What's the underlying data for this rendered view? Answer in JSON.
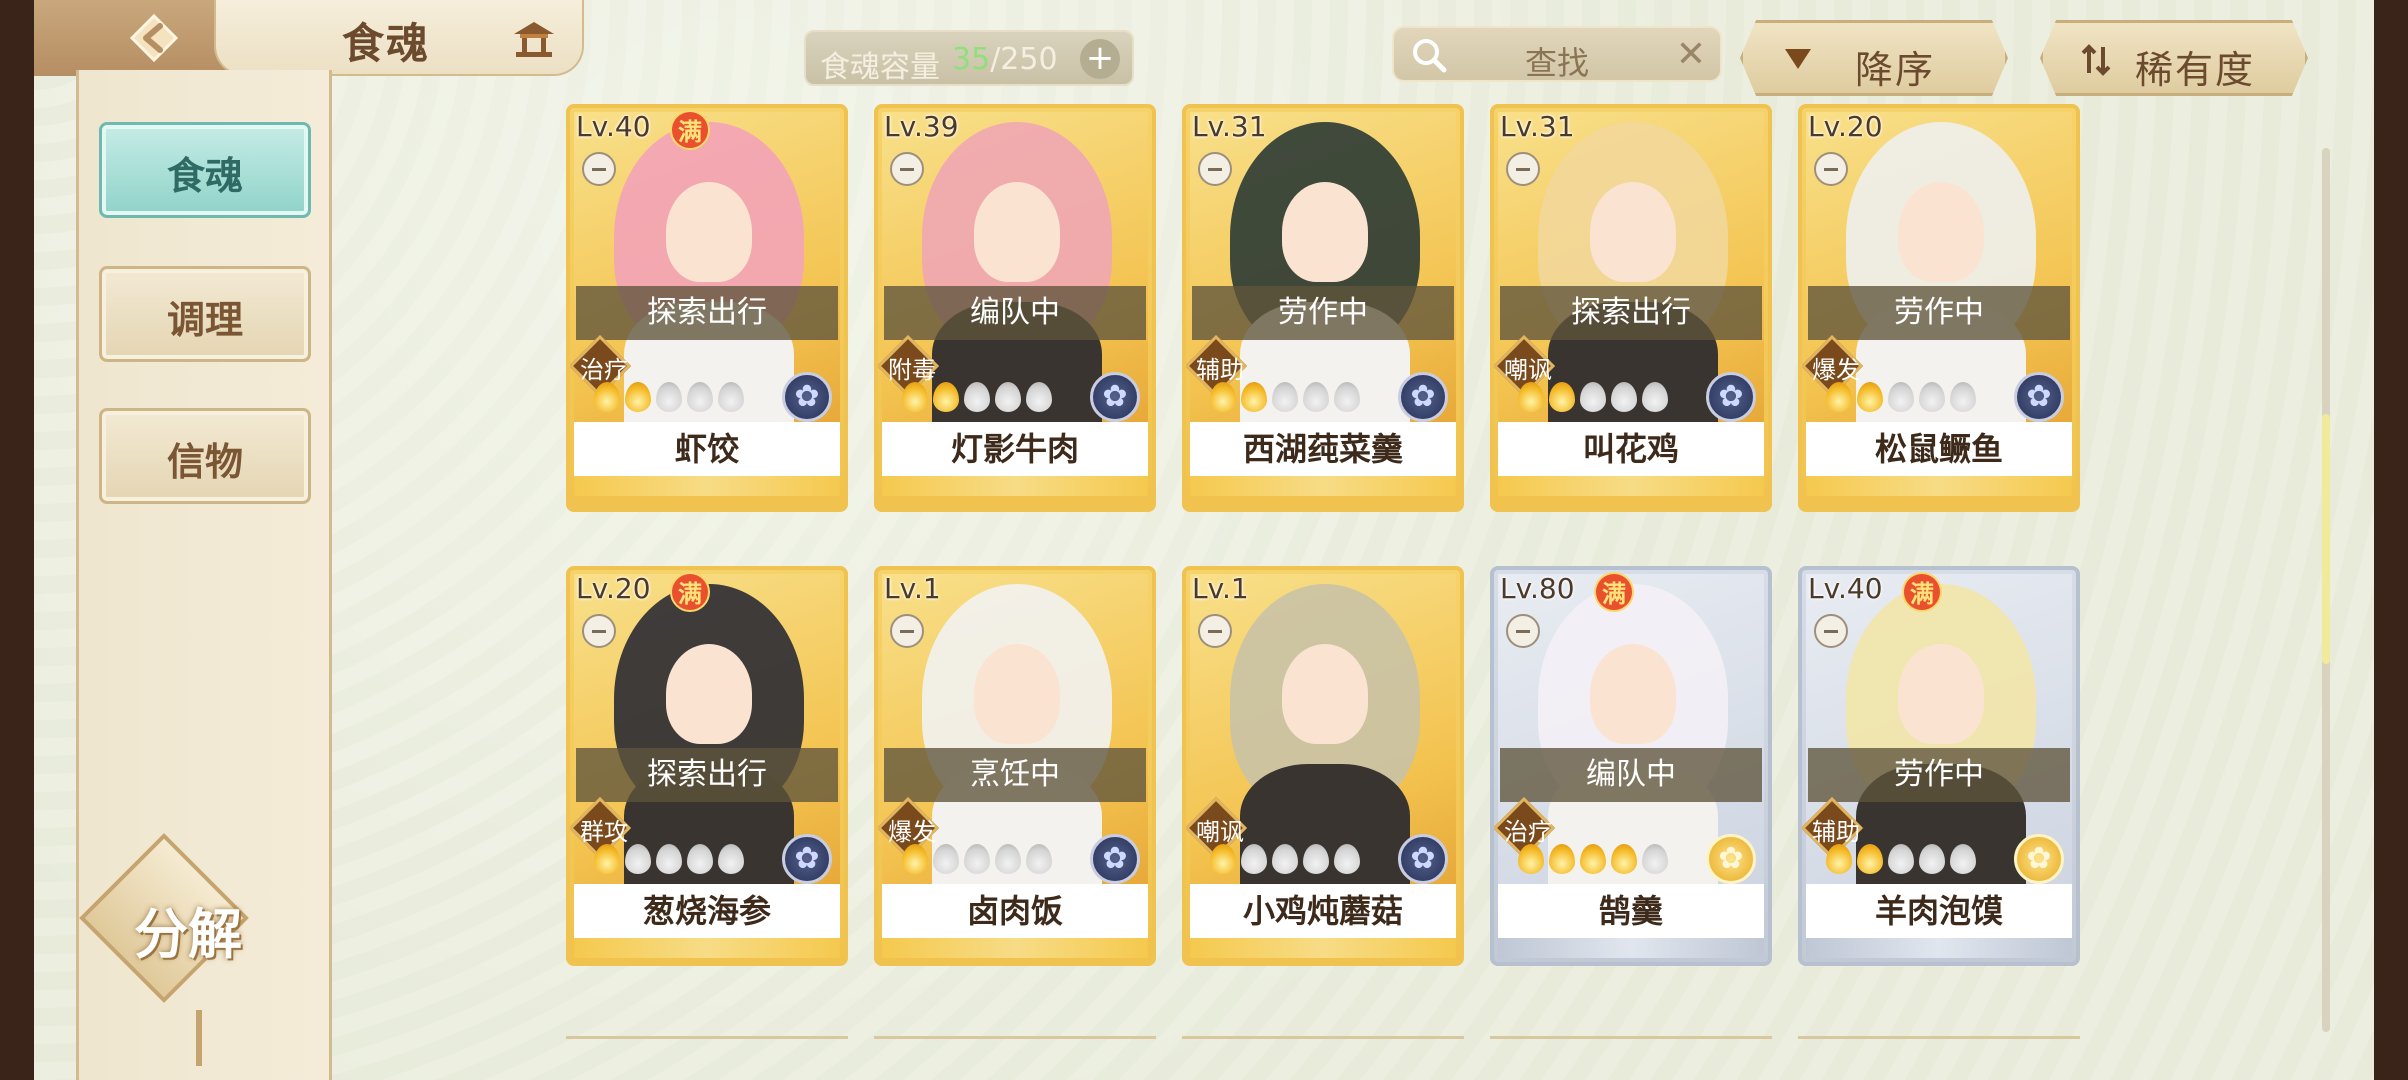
{
  "header": {
    "title": "食魂",
    "capacity_label": "食魂容量",
    "capacity_current": "35",
    "capacity_total": "/250",
    "capacity_plus": "+",
    "search_placeholder": "查找",
    "search_clear": "✕",
    "sort_label": "降序",
    "rarity_label": "稀有度"
  },
  "sidebar": {
    "items": [
      {
        "label": "食魂",
        "active": true
      },
      {
        "label": "调理",
        "active": false
      },
      {
        "label": "信物",
        "active": false
      }
    ],
    "decompose_label": "分解"
  },
  "cards": [
    {
      "level": "Lv.40",
      "full": true,
      "full_label": "满",
      "status": "探索出行",
      "role": "治疗",
      "stars": 2,
      "name": "虾饺",
      "frame": "gold",
      "emblem": "blue"
    },
    {
      "level": "Lv.39",
      "full": false,
      "status": "编队中",
      "role": "附毒",
      "stars": 2,
      "name": "灯影牛肉",
      "frame": "gold",
      "emblem": "blue"
    },
    {
      "level": "Lv.31",
      "full": false,
      "status": "劳作中",
      "role": "辅助",
      "stars": 2,
      "name": "西湖莼菜羹",
      "frame": "gold",
      "emblem": "blue"
    },
    {
      "level": "Lv.31",
      "full": false,
      "status": "探索出行",
      "role": "嘲讽",
      "stars": 2,
      "name": "叫花鸡",
      "frame": "gold",
      "emblem": "blue"
    },
    {
      "level": "Lv.20",
      "full": false,
      "status": "劳作中",
      "role": "爆发",
      "stars": 2,
      "name": "松鼠鳜鱼",
      "frame": "gold",
      "emblem": "blue"
    },
    {
      "level": "Lv.20",
      "full": true,
      "full_label": "满",
      "status": "探索出行",
      "role": "群攻",
      "stars": 1,
      "name": "葱烧海参",
      "frame": "gold",
      "emblem": "blue"
    },
    {
      "level": "Lv.1",
      "full": false,
      "status": "烹饪中",
      "role": "爆发",
      "stars": 1,
      "name": "卤肉饭",
      "frame": "gold",
      "emblem": "blue"
    },
    {
      "level": "Lv.1",
      "full": false,
      "status": "",
      "role": "嘲讽",
      "stars": 1,
      "name": "小鸡炖蘑菇",
      "frame": "gold",
      "emblem": "blue"
    },
    {
      "level": "Lv.80",
      "full": true,
      "full_label": "满",
      "status": "编队中",
      "role": "治疗",
      "stars": 4,
      "name": "鹄羹",
      "frame": "silver",
      "emblem": "gold"
    },
    {
      "level": "Lv.40",
      "full": true,
      "full_label": "满",
      "status": "劳作中",
      "role": "辅助",
      "stars": 2,
      "name": "羊肉泡馍",
      "frame": "silver",
      "emblem": "gold"
    }
  ],
  "colors": {
    "accent_teal": "#8fd3c9",
    "gold_frame": "#f0c24f",
    "silver_frame": "#b7c0ce",
    "full_badge": "#e8502e"
  }
}
